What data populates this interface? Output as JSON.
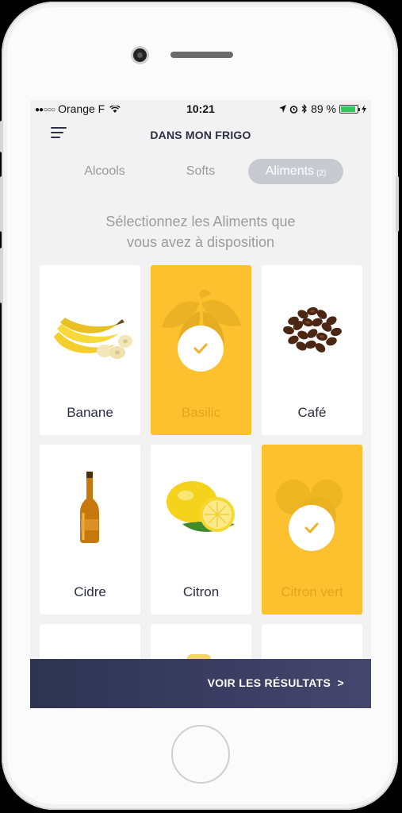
{
  "status_bar": {
    "carrier": "Orange F",
    "time": "10:21",
    "battery": "89 %"
  },
  "header": {
    "title": "DANS MON FRIGO"
  },
  "tabs": [
    {
      "label": "Alcools",
      "count": "",
      "active": false
    },
    {
      "label": "Softs",
      "count": "",
      "active": false
    },
    {
      "label": "Aliments",
      "count": "(2)",
      "active": true
    }
  ],
  "instruction": {
    "line1": "Sélectionnez les Aliments que",
    "line2": "vous avez à disposition"
  },
  "items": [
    {
      "label": "Banane",
      "selected": false,
      "icon": "banana-image"
    },
    {
      "label": "Basilic",
      "selected": true,
      "icon": "basil-image"
    },
    {
      "label": "Café",
      "selected": false,
      "icon": "coffee-beans-image"
    },
    {
      "label": "Cidre",
      "selected": false,
      "icon": "cider-bottle-image"
    },
    {
      "label": "Citron",
      "selected": false,
      "icon": "lemon-image"
    },
    {
      "label": "Citron vert",
      "selected": true,
      "icon": "lime-image"
    }
  ],
  "footer": {
    "results_label": "VOIR LES RÉSULTATS  >"
  },
  "colors": {
    "accent_yellow": "#fdc02f",
    "navy": "#2b2f45",
    "tab_pill": "#c7cbd1"
  }
}
